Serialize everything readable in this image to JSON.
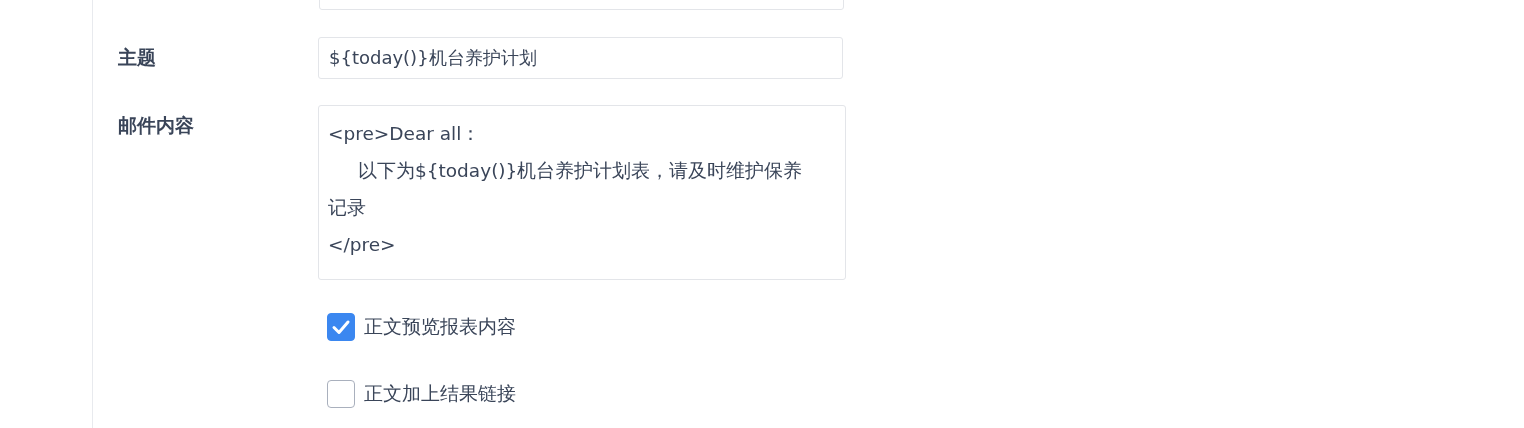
{
  "form": {
    "subject": {
      "label": "主题",
      "value": "${today()}机台养护计划"
    },
    "body": {
      "label": "邮件内容",
      "lines": [
        {
          "text": "<pre>Dear all：",
          "indent": false
        },
        {
          "text": "以下为${today()}机台养护计划表，请及时维护保养记录",
          "indent": true
        },
        {
          "text": "</pre>",
          "indent": false
        }
      ]
    },
    "options": [
      {
        "label": "正文预览报表内容",
        "checked": true
      },
      {
        "label": "正文加上结果链接",
        "checked": false
      }
    ]
  }
}
